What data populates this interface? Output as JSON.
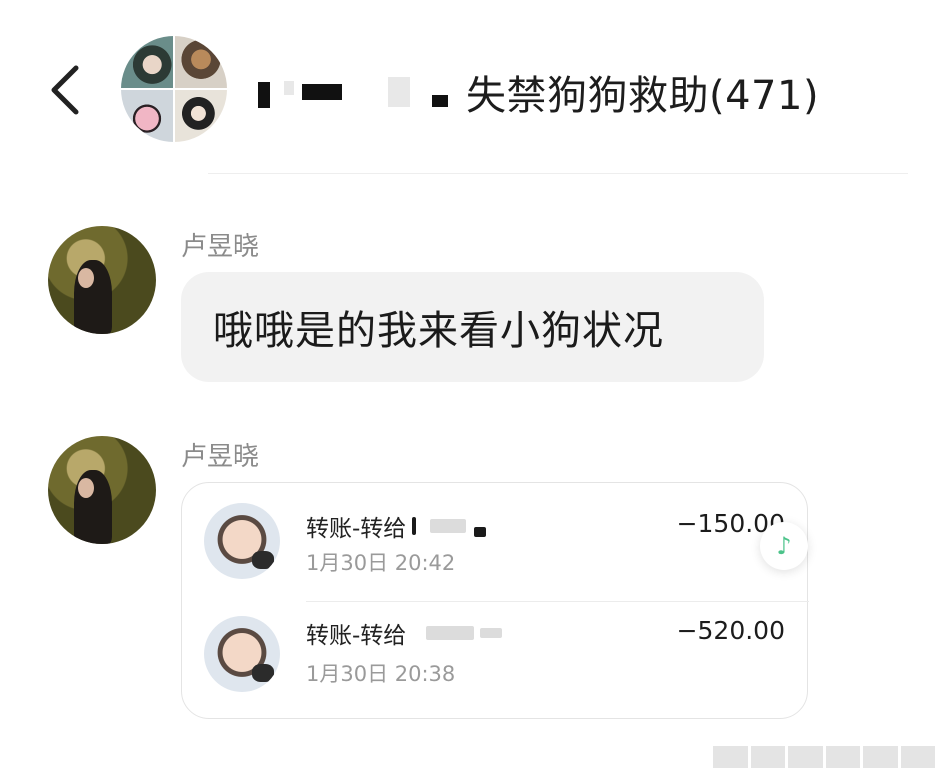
{
  "header": {
    "title": "失禁狗狗救助(471)"
  },
  "messages": [
    {
      "sender": "卢昱晓",
      "text": "哦哦是的我来看小狗状况"
    },
    {
      "sender": "卢昱晓",
      "transfers": [
        {
          "label": "转账-转给",
          "amount": "−150.00",
          "time": "1月30日 20:42"
        },
        {
          "label": "转账-转给",
          "amount": "−520.00",
          "time": "1月30日 20:38"
        }
      ]
    }
  ],
  "icons": {
    "back": "chevron-left-icon",
    "music": "music-note-icon"
  },
  "colors": {
    "accent_green": "#4cc38a",
    "bubble_bg": "#f2f2f2",
    "meta_gray": "#9a9a9a"
  }
}
